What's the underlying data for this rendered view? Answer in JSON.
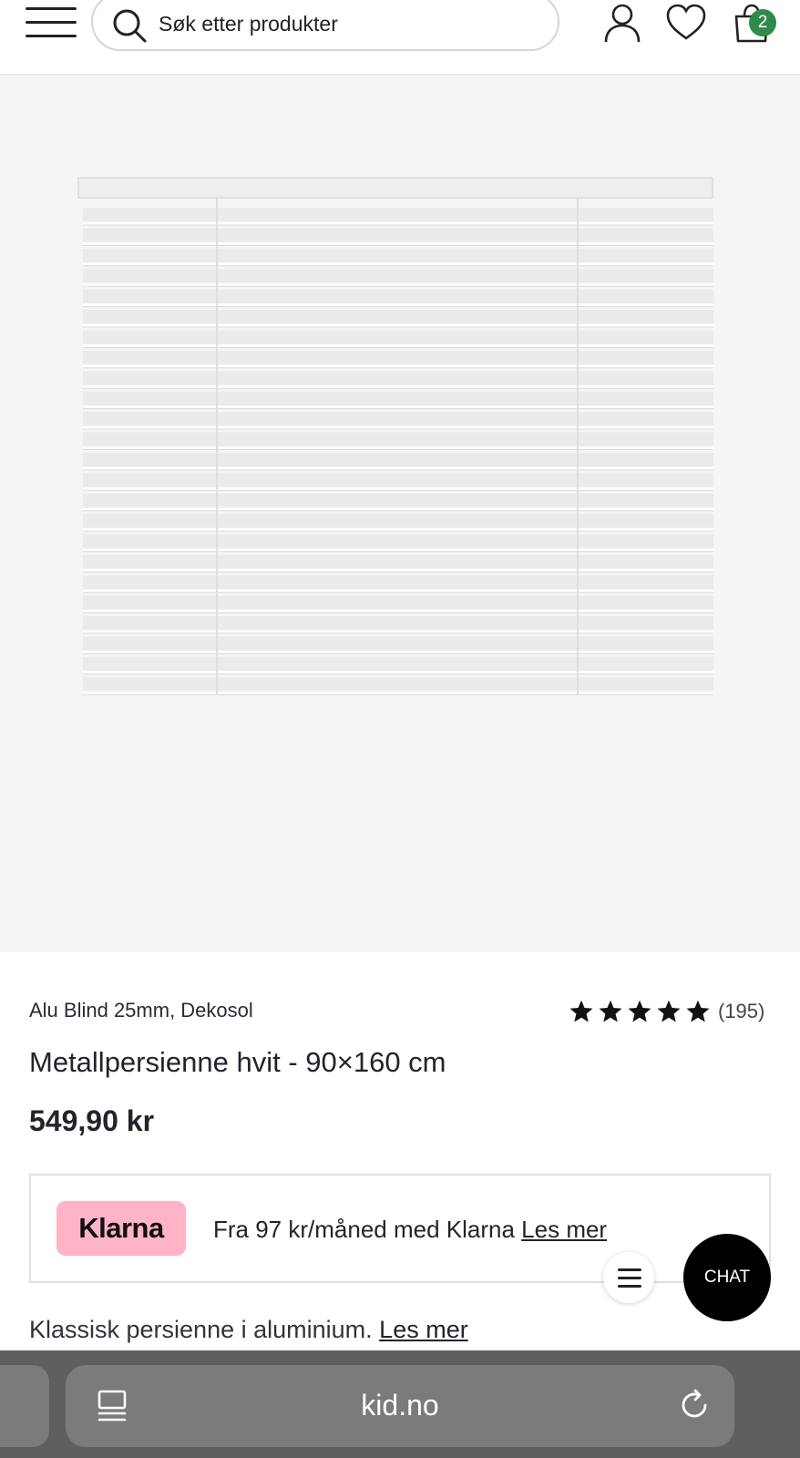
{
  "header": {
    "search_placeholder": "Søk etter produkter",
    "cart_count": "2",
    "icons": [
      "menu-icon",
      "search-icon",
      "user-icon",
      "heart-icon",
      "bag-icon"
    ],
    "cart_badge_color": "#2e8b4a"
  },
  "product": {
    "brand_line": "Alu Blind 25mm, Dekosol",
    "rating": {
      "stars": 5,
      "max": 5,
      "count": "(195)"
    },
    "title": "Metallpersienne hvit - 90×160 cm",
    "price": "549,90 kr"
  },
  "klarna": {
    "badge": "Klarna",
    "text": "Fra 97 kr/måned med Klarna",
    "link": "Les mer",
    "badge_color": "#ffb3c7"
  },
  "description": {
    "text": "Klassisk persienne i aluminium.",
    "link": "Les mer"
  },
  "chat": {
    "label": "CHAT"
  },
  "browser": {
    "url": "kid.no"
  }
}
